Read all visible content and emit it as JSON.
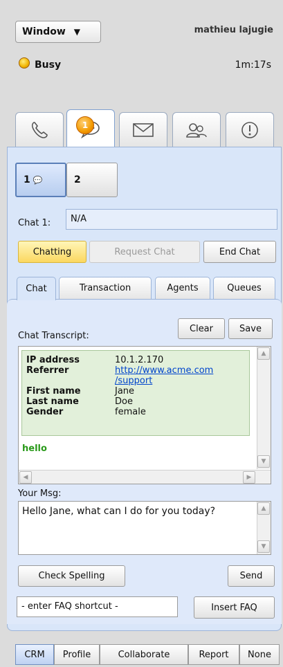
{
  "header": {
    "window_menu_label": "Window",
    "user_name": "mathieu lajugie",
    "status": "Busy",
    "timer": "1m:17s"
  },
  "main_tabs": [
    {
      "name": "phone",
      "icon": "phone-icon"
    },
    {
      "name": "chat",
      "icon": "chat-icon",
      "badge": "1",
      "active": true
    },
    {
      "name": "email",
      "icon": "envelope-icon"
    },
    {
      "name": "contacts",
      "icon": "people-icon"
    },
    {
      "name": "alerts",
      "icon": "alert-icon"
    }
  ],
  "sessions": [
    {
      "label": "1",
      "active": true
    },
    {
      "label": "2"
    }
  ],
  "chat_field": {
    "label": "Chat 1:",
    "value": "N/A"
  },
  "chat_actions": {
    "chatting": "Chatting",
    "request": "Request Chat",
    "end": "End Chat"
  },
  "sub_tabs": [
    {
      "label": "Chat",
      "active": true
    },
    {
      "label": "Transaction"
    },
    {
      "label": "Agents"
    },
    {
      "label": "Queues"
    }
  ],
  "transcript": {
    "label": "Chat Transcript:",
    "clear_label": "Clear",
    "save_label": "Save",
    "info": [
      {
        "key": "IP address",
        "value": "10.1.2.170"
      },
      {
        "key": "Referrer",
        "value": "http://www.acme.com/support",
        "value_line1": "http://www.acme.com",
        "value_line2": "/support"
      },
      {
        "key": "First name",
        "value": "Jane"
      },
      {
        "key": "Last name",
        "value": "Doe"
      },
      {
        "key": "Gender",
        "value": "female"
      }
    ],
    "messages": [
      "hello"
    ]
  },
  "compose": {
    "label": "Your Msg:",
    "text": "Hello Jane, what can I do for you today?",
    "check_spelling_label": "Check Spelling",
    "send_label": "Send"
  },
  "faq": {
    "value": "- enter FAQ shortcut -",
    "insert_label": "Insert FAQ"
  },
  "bottom_tabs": [
    {
      "label": "CRM",
      "active": true
    },
    {
      "label": "Profile"
    },
    {
      "label": "Collaborate"
    },
    {
      "label": "Report"
    },
    {
      "label": "None"
    }
  ],
  "colors": {
    "panel_bg": "#d9e6f9",
    "chatting_yellow": "#fbd860",
    "link_blue": "#0044cc",
    "message_green": "#2a9a1a",
    "info_bg": "#e2f0da"
  }
}
